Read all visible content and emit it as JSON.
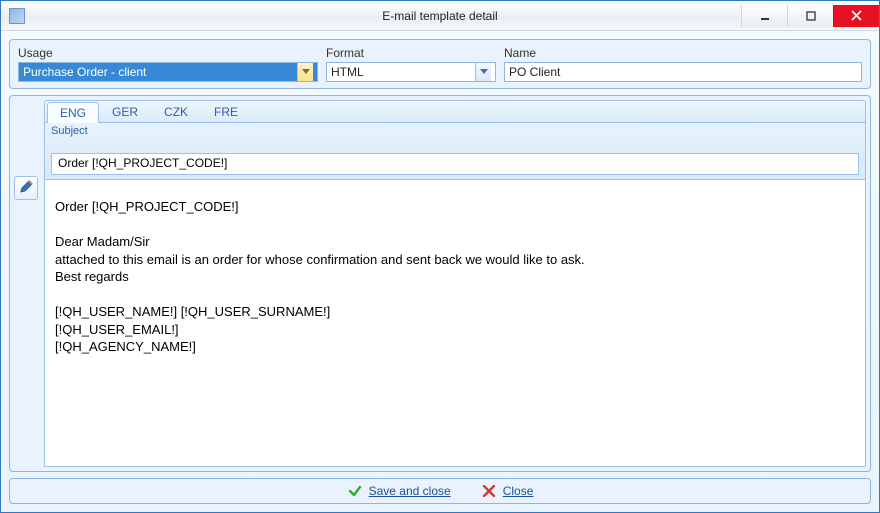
{
  "window": {
    "title": "E-mail template detail"
  },
  "fields": {
    "usage_label": "Usage",
    "usage_value": "Purchase Order - client",
    "format_label": "Format",
    "format_value": "HTML",
    "name_label": "Name",
    "name_value": "PO Client"
  },
  "tabs": {
    "items": [
      "ENG",
      "GER",
      "CZK",
      "FRE"
    ],
    "active_index": 0
  },
  "subject": {
    "label": "Subject",
    "value": "Order [!QH_PROJECT_CODE!]"
  },
  "body": "Order [!QH_PROJECT_CODE!]\n\nDear Madam/Sir\nattached to this email is an order for whose confirmation and sent back we would like to ask.\nBest regards\n\n[!QH_USER_NAME!] [!QH_USER_SURNAME!]\n[!QH_USER_EMAIL!]\n[!QH_AGENCY_NAME!]",
  "footer": {
    "save": "Save and close",
    "close": "Close"
  }
}
